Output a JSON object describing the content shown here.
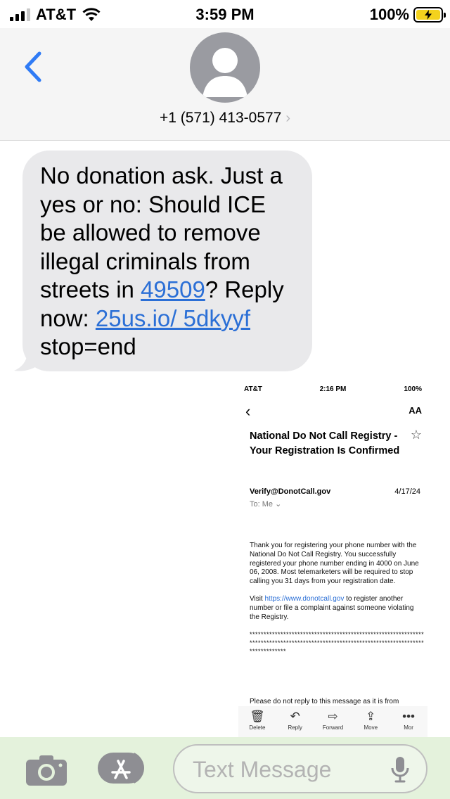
{
  "status_bar": {
    "carrier": "AT&T",
    "time": "3:59 PM",
    "battery": "100%"
  },
  "header": {
    "contact": "+1 (571) 413-0577",
    "chevron": "›"
  },
  "message": {
    "text_before_zip": "No donation ask. Just a yes or no: Should ICE be allowed to remove illegal criminals from streets in ",
    "zip_link": "49509",
    "text_after_zip": "? Reply now: ",
    "url_link": "25us.io/ 5dkyyf",
    "text_end": " stop=end"
  },
  "attachment": {
    "status": {
      "carrier": "AT&T",
      "time": "2:16 PM",
      "battery": "100%"
    },
    "back": "‹",
    "text_size": "AA",
    "subject": "National Do Not Call Registry - Your Registration Is Confirmed",
    "star": "☆",
    "from": "Verify@DonotCall.gov",
    "date": "4/17/24",
    "to": "To: Me ⌄",
    "body_p1": "Thank you for registering your phone number with the National Do Not Call Registry. You successfully registered your phone number ending in 4000 on June 06, 2008. Most telemarketers will be required to stop calling you 31 days from your registration date.",
    "body_p2_pre": "Visit ",
    "body_p2_link": "https://www.donotcall.gov",
    "body_p2_post": "  to register another number or file a complaint against someone violating the Registry.",
    "dots": "*****************************************************************************************************************************************",
    "cut_line": "Please do not reply to this message as it is from",
    "toolbar": [
      {
        "icon": "🗑",
        "label": "Delete"
      },
      {
        "icon": "↶",
        "label": "Reply"
      },
      {
        "icon": "⇨",
        "label": "Forward"
      },
      {
        "icon": "⇪",
        "label": "Move"
      },
      {
        "icon": "•••",
        "label": "Mor"
      }
    ]
  },
  "input": {
    "placeholder": "Text Message"
  },
  "colors": {
    "link": "#2b6fd6",
    "bubble": "#e9e9eb",
    "back_chevron": "#2f7bf5",
    "avatar": "#9a9ba1",
    "battery_fill": "#f3d21d",
    "bottom_bar": "#e4f2dc"
  }
}
